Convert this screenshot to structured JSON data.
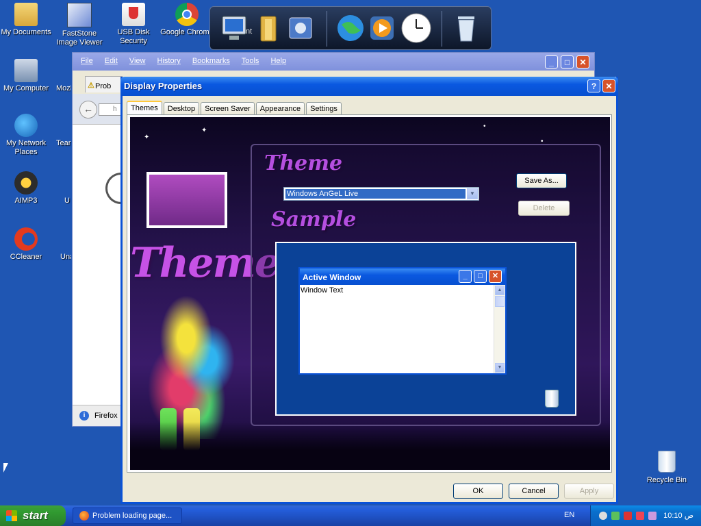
{
  "desktop_icons": [
    {
      "name": "desktop-icon-my-documents",
      "label": "My Documents",
      "icon": "folder-documents-icon"
    },
    {
      "name": "desktop-icon-faststone",
      "label": "FastStone Image Viewer",
      "icon": "faststone-icon"
    },
    {
      "name": "desktop-icon-usb-disk-security",
      "label": "USB Disk Security",
      "icon": "shield-usb-icon"
    },
    {
      "name": "desktop-icon-google-chrome",
      "label": "Google Chrome",
      "icon": "chrome-icon"
    },
    {
      "name": "desktop-icon-my-computer",
      "label": "My Computer",
      "icon": "computer-icon"
    },
    {
      "name": "desktop-icon-mozilla",
      "label": "Mozi",
      "icon": "firefox-icon"
    },
    {
      "name": "desktop-icon-my-network-places",
      "label": "My Network Places",
      "icon": "network-icon"
    },
    {
      "name": "desktop-icon-team",
      "label": "Tear",
      "icon": "teamviewer-icon"
    },
    {
      "name": "desktop-icon-aimp3",
      "label": "AIMP3",
      "icon": "aimp-icon"
    },
    {
      "name": "desktop-icon-u",
      "label": "U",
      "icon": "app-icon"
    },
    {
      "name": "desktop-icon-ccleaner",
      "label": "CCleaner",
      "icon": "ccleaner-icon"
    },
    {
      "name": "desktop-icon-una",
      "label": "Una",
      "icon": "app-icon"
    },
    {
      "name": "desktop-icon-recycle-bin",
      "label": "Recycle Bin",
      "icon": "recycle-bin-icon"
    }
  ],
  "dock": {
    "items": [
      "computer-icon",
      "folder-icon",
      "system-icon",
      "globe-icon",
      "media-player-icon",
      "clock-icon",
      "recycle-bin-icon"
    ],
    "partial_label": "nt"
  },
  "firefox": {
    "menu": [
      "File",
      "Edit",
      "View",
      "History",
      "Bookmarks",
      "Tools",
      "Help"
    ],
    "tab_title": "Prob",
    "url_fragment": "h",
    "status_text": "Firefox"
  },
  "dialog": {
    "title": "Display Properties",
    "tabs": [
      "Themes",
      "Desktop",
      "Screen Saver",
      "Appearance",
      "Settings"
    ],
    "active_tab": "Themes",
    "art": {
      "big_title": "Themes",
      "theme_label": "Theme",
      "sample_label": "Sample"
    },
    "theme_select_value": "Windows AnGeL Live",
    "save_as_label": "Save As...",
    "delete_label": "Delete",
    "sample_window": {
      "title": "Active Window",
      "text": "Window Text"
    },
    "ok_label": "OK",
    "cancel_label": "Cancel",
    "apply_label": "Apply"
  },
  "taskbar": {
    "start_label": "start",
    "task_label": "Problem loading page...",
    "language": "EN",
    "clock": "10:10 ص"
  }
}
